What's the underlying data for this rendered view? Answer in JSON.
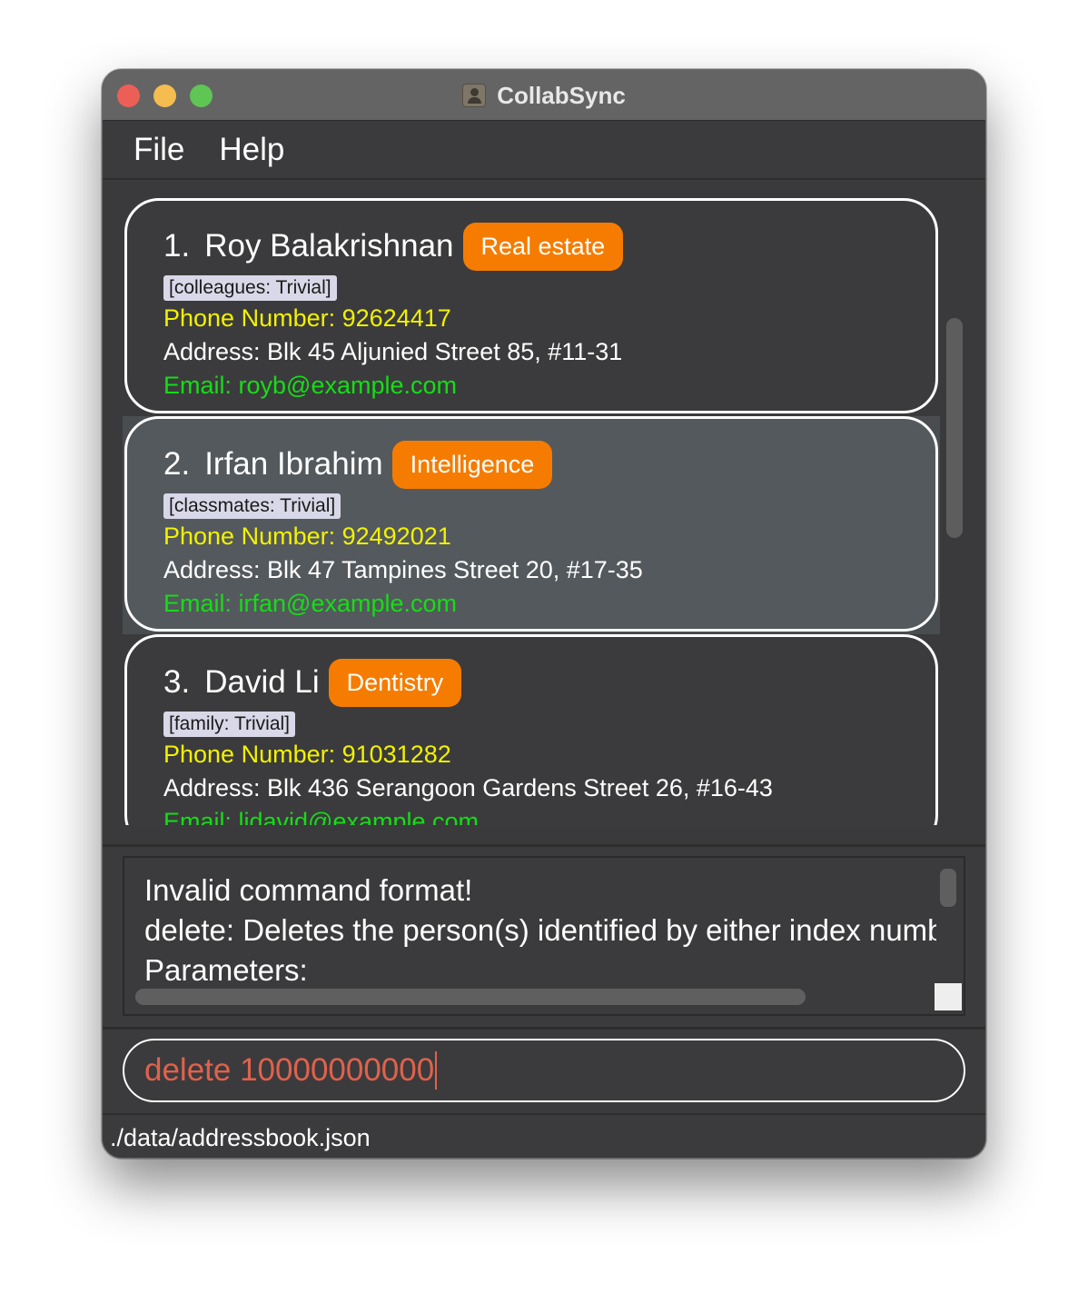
{
  "window": {
    "title": "CollabSync"
  },
  "menu": {
    "items": [
      {
        "label": "File"
      },
      {
        "label": "Help"
      }
    ]
  },
  "persons": [
    {
      "index": "1.",
      "name": "Roy Balakrishnan",
      "badge": "Real estate",
      "tag": "[colleagues: Trivial]",
      "phone": "Phone Number: 92624417",
      "address": "Address: Blk 45 Aljunied Street 85, #11-31",
      "email": "Email: royb@example.com",
      "selected": false
    },
    {
      "index": "2.",
      "name": "Irfan Ibrahim",
      "badge": "Intelligence",
      "tag": "[classmates: Trivial]",
      "phone": "Phone Number: 92492021",
      "address": "Address: Blk 47 Tampines Street 20, #17-35",
      "email": "Email: irfan@example.com",
      "selected": true
    },
    {
      "index": "3.",
      "name": "David Li",
      "badge": "Dentistry",
      "tag": "[family: Trivial]",
      "phone": "Phone Number: 91031282",
      "address": "Address: Blk 436 Serangoon Gardens Street 26, #16-43",
      "email": "Email: lidavid@example.com",
      "selected": false
    }
  ],
  "result": {
    "lines": [
      "Invalid command format!",
      "delete: Deletes the person(s) identified by either index numb",
      "Parameters:"
    ]
  },
  "command": {
    "value": "delete 10000000000"
  },
  "status": {
    "path": "./data/addressbook.json"
  },
  "colors": {
    "badge": "#f57c00",
    "phone": "#f2f200",
    "email": "#16dd16",
    "command_text": "#e0624c",
    "selected_row": "#54595d"
  }
}
